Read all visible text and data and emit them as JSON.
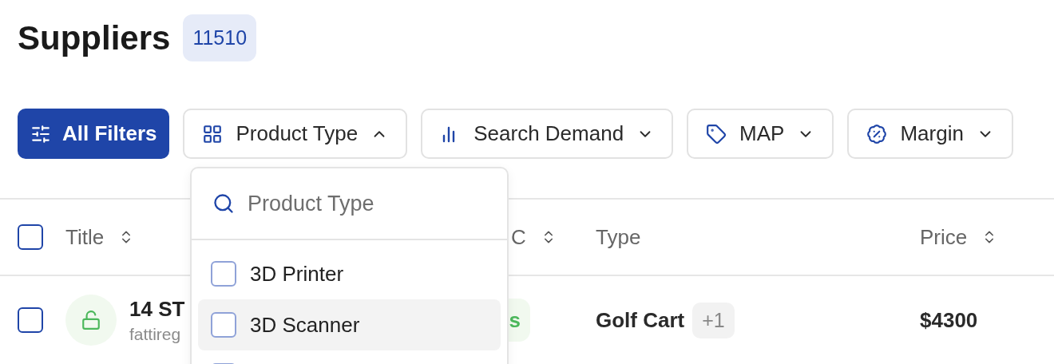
{
  "page": {
    "title": "Suppliers",
    "count": "11510"
  },
  "filters": [
    {
      "label": "All Filters",
      "kind": "primary"
    },
    {
      "label": "Product Type",
      "kind": "dropdown",
      "expanded": true
    },
    {
      "label": "Search Demand",
      "kind": "dropdown",
      "expanded": false
    },
    {
      "label": "MAP",
      "kind": "dropdown",
      "expanded": false
    },
    {
      "label": "Margin",
      "kind": "dropdown",
      "expanded": false
    }
  ],
  "dropdown": {
    "placeholder": "Product Type",
    "options": [
      {
        "label": "3D Printer",
        "checked": false,
        "selected": false
      },
      {
        "label": "3D Scanner",
        "checked": false,
        "selected": true
      },
      {
        "selected": false
      }
    ]
  },
  "table": {
    "all_checked": false,
    "columns": [
      {
        "label": "Title",
        "sortable": true
      },
      {
        "label": "C",
        "sortable": true
      },
      {
        "label": "Type",
        "sortable": false
      },
      {
        "label": "Price",
        "sortable": true
      }
    ],
    "rows": [
      {
        "checked": false,
        "locked": false,
        "title": "14 ST",
        "subtitle": "fattireg",
        "status": "s",
        "type": "Golf Cart",
        "type_more": "+1",
        "price": "$4300"
      }
    ]
  }
}
